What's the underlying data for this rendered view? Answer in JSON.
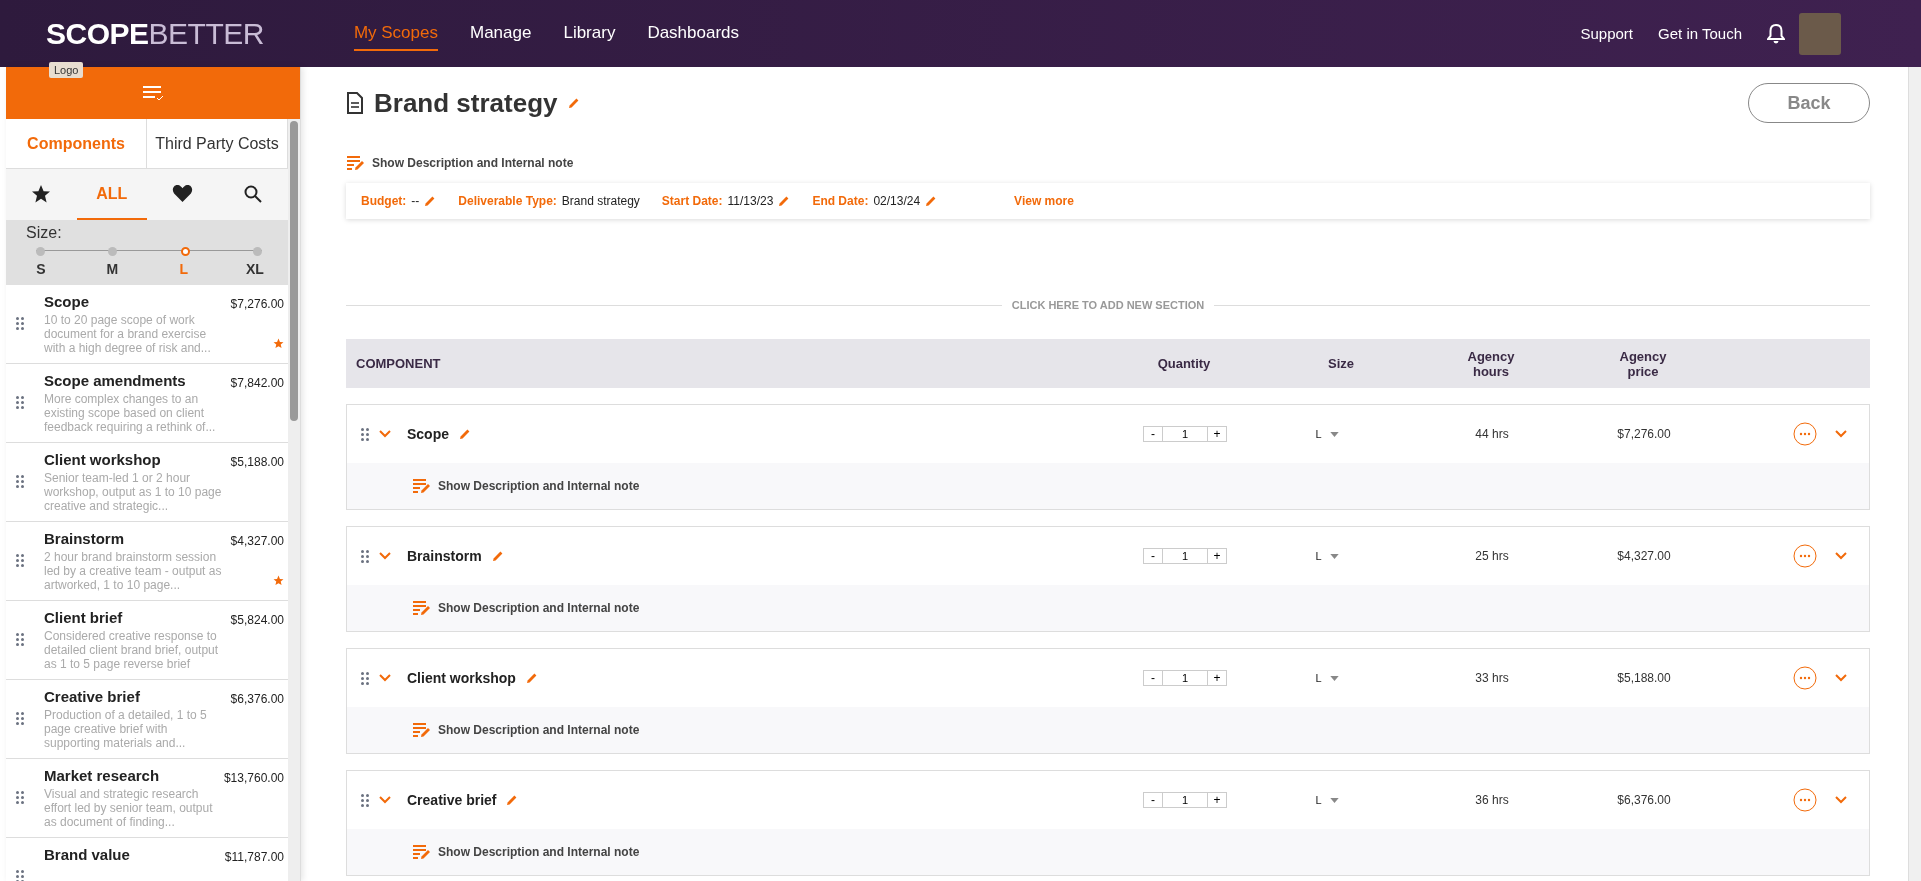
{
  "header": {
    "logo": {
      "strong": "SCOPE",
      "light": "BETTER"
    },
    "tooltip": "Logo",
    "nav": [
      {
        "label": "My Scopes",
        "selected": true
      },
      {
        "label": "Manage",
        "selected": false
      },
      {
        "label": "Library",
        "selected": false
      },
      {
        "label": "Dashboards",
        "selected": false
      }
    ],
    "links": [
      "Support",
      "Get in Touch"
    ]
  },
  "sidebar": {
    "tabs": [
      {
        "label": "Components",
        "selected": true
      },
      {
        "label": "Third Party Costs",
        "selected": false
      }
    ],
    "filters": [
      {
        "kind": "star",
        "selected": false
      },
      {
        "kind": "text",
        "label": "ALL",
        "selected": true
      },
      {
        "kind": "heart",
        "selected": false
      },
      {
        "kind": "search",
        "selected": false
      }
    ],
    "size": {
      "label": "Size:",
      "options": [
        {
          "label": "S",
          "selected": false
        },
        {
          "label": "M",
          "selected": false
        },
        {
          "label": "L",
          "selected": true
        },
        {
          "label": "XL",
          "selected": false
        }
      ]
    },
    "items": [
      {
        "name": "Scope",
        "price": "$7,276.00",
        "description": "10 to 20 page scope of work document for a brand exercise with a high degree of risk and...",
        "starred": true
      },
      {
        "name": "Scope amendments",
        "price": "$7,842.00",
        "description": "More complex changes to an existing scope based on client feedback requiring a rethink of...",
        "starred": false
      },
      {
        "name": "Client workshop",
        "price": "$5,188.00",
        "description": "Senior team-led 1 or 2 hour workshop, output as 1 to 10 page creative and strategic...",
        "starred": false
      },
      {
        "name": "Brainstorm",
        "price": "$4,327.00",
        "description": "2 hour brand brainstorm session led by a creative team - output as artworked, 1 to 10 page...",
        "starred": true
      },
      {
        "name": "Client brief",
        "price": "$5,824.00",
        "description": "Considered creative response to detailed client brand brief, output as 1 to 5 page reverse brief",
        "starred": false
      },
      {
        "name": "Creative brief",
        "price": "$6,376.00",
        "description": "Production of a detailed, 1 to 5 page creative brief with supporting materials and...",
        "starred": false
      },
      {
        "name": "Market research",
        "price": "$13,760.00",
        "description": "Visual and strategic research effort led by senior team, output as document of finding...",
        "starred": false
      },
      {
        "name": "Brand value",
        "price": "$11,787.00",
        "starred": false
      }
    ]
  },
  "main": {
    "title": "Brand strategy",
    "back": "Back",
    "show_note": "Show Description and Internal note",
    "meta": [
      {
        "label": "Budget:",
        "value": "--",
        "editable": true
      },
      {
        "label": "Deliverable Type:",
        "value": "Brand strategy",
        "editable": false
      },
      {
        "label": "Start Date:",
        "value": "11/13/23",
        "editable": true
      },
      {
        "label": "End Date:",
        "value": "02/13/24",
        "editable": true
      }
    ],
    "view_more": "View more",
    "add_section": "CLICK HERE TO ADD NEW SECTION",
    "columns": [
      "COMPONENT",
      "Quantity",
      "Size",
      "Agency hours",
      "Agency price"
    ],
    "rows": [
      {
        "name": "Scope",
        "minus": "-",
        "quantity": "1",
        "plus": "+",
        "size": "L",
        "hours": "44 hrs",
        "price": "$7,276.00",
        "note": "Show Description and Internal note"
      },
      {
        "name": "Brainstorm",
        "minus": "-",
        "quantity": "1",
        "plus": "+",
        "size": "L",
        "hours": "25 hrs",
        "price": "$4,327.00",
        "note": "Show Description and Internal note"
      },
      {
        "name": "Client workshop",
        "minus": "-",
        "quantity": "1",
        "plus": "+",
        "size": "L",
        "hours": "33 hrs",
        "price": "$5,188.00",
        "note": "Show Description and Internal note"
      },
      {
        "name": "Creative brief",
        "minus": "-",
        "quantity": "1",
        "plus": "+",
        "size": "L",
        "hours": "36 hrs",
        "price": "$6,376.00",
        "note": "Show Description and Internal note"
      }
    ]
  }
}
